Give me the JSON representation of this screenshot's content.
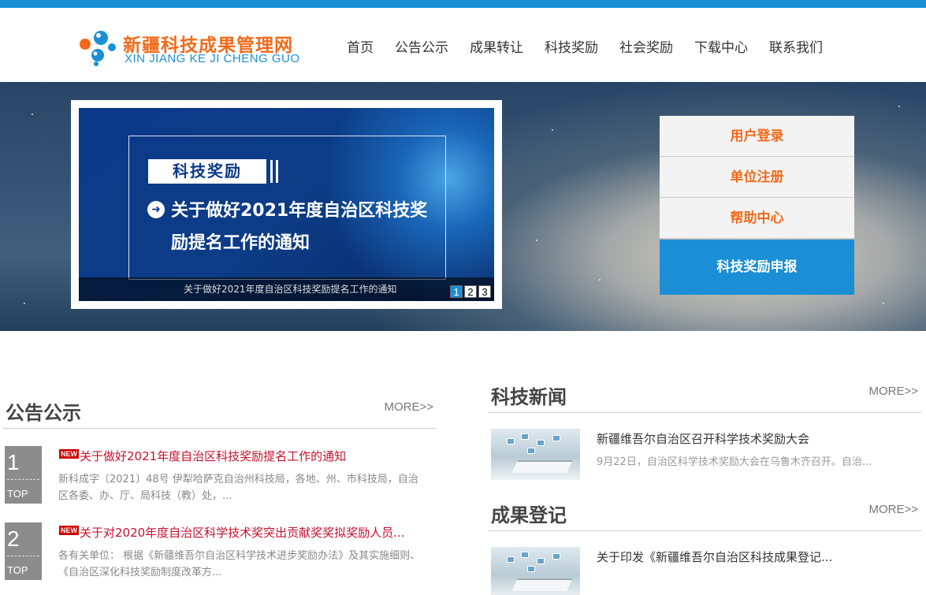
{
  "site": {
    "logo_cn": "新疆科技成果管理网",
    "logo_en": "XIN JIANG KE JI CHENG GUO",
    "brand_color": "#1b8fd6",
    "accent_color": "#f26a1b"
  },
  "nav": [
    "首页",
    "公告公示",
    "成果转让",
    "科技奖励",
    "社会奖励",
    "下载中心",
    "联系我们"
  ],
  "slider": {
    "tag": "科技奖励",
    "headline_line1": "关于做好2021年度自治区科技奖",
    "headline_line2": "励提名工作的通知",
    "caption": "关于做好2021年度自治区科技奖励提名工作的通知",
    "pages": [
      "1",
      "2",
      "3"
    ],
    "active_page": "1"
  },
  "sidebox": {
    "login": "用户登录",
    "register": "单位注册",
    "help": "帮助中心",
    "apply": "科技奖励申报"
  },
  "notices": {
    "title": "公告公示",
    "more": "MORE>>",
    "items": [
      {
        "rank": "1",
        "top": "TOP",
        "new": "NEW",
        "title": "关于做好2021年度自治区科技奖励提名工作的通知",
        "desc": "新科成字〔2021〕48号 伊犁哈萨克自治州科技局，各地、州、市科技局，自治区各委、办、厅、局科技（教）处，..."
      },
      {
        "rank": "2",
        "top": "TOP",
        "new": "NEW",
        "title": "关于对2020年度自治区科学技术奖突出贡献奖奖拟奖励人员...",
        "desc": "各有关单位： 根据《新疆维吾尔自治区科学技术进步奖励办法》及其实施细则、《自治区深化科技奖励制度改革方..."
      }
    ]
  },
  "news": {
    "title": "科技新闻",
    "more": "MORE>>",
    "items": [
      {
        "title": "新疆维吾尔自治区召开科学技术奖励大会",
        "desc": "9月22日，自治区科学技术奖励大会在乌鲁木齐召开。自治..."
      }
    ]
  },
  "registry": {
    "title": "成果登记",
    "more": "MORE>>",
    "items": [
      {
        "title": "关于印发《新疆维吾尔自治区科技成果登记...",
        "desc": ""
      }
    ]
  }
}
